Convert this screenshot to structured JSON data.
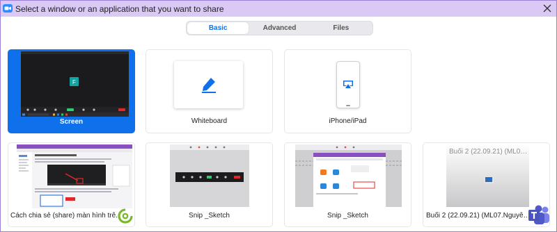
{
  "window": {
    "title": "Select a window or an application that you want to share",
    "accent": "#0e71eb",
    "title_bar_color": "#d9c9f4"
  },
  "tabs": [
    {
      "label": "Basic",
      "active": true
    },
    {
      "label": "Advanced",
      "active": false
    },
    {
      "label": "Files",
      "active": false
    }
  ],
  "tiles": {
    "screen": {
      "label": "Screen",
      "avatar_letter": "F",
      "selected": true
    },
    "whiteboard": {
      "label": "Whiteboard",
      "icon": "pen-icon"
    },
    "iphone": {
      "label": "iPhone/iPad",
      "icon": "airplay-icon"
    }
  },
  "windows": [
    {
      "label": "Cách chia sẻ (share) màn hình trê...",
      "app_icon": "coccoc-browser-icon"
    },
    {
      "label": "Snip _Sketch"
    },
    {
      "label": "Snip _Sketch"
    },
    {
      "label": "Buổi 2 (22.09.21) (ML07.Nguyễn ...",
      "thumb_title": "Buổi 2 (22.09.21) (ML07.N...",
      "app_icon": "teams-icon"
    }
  ]
}
